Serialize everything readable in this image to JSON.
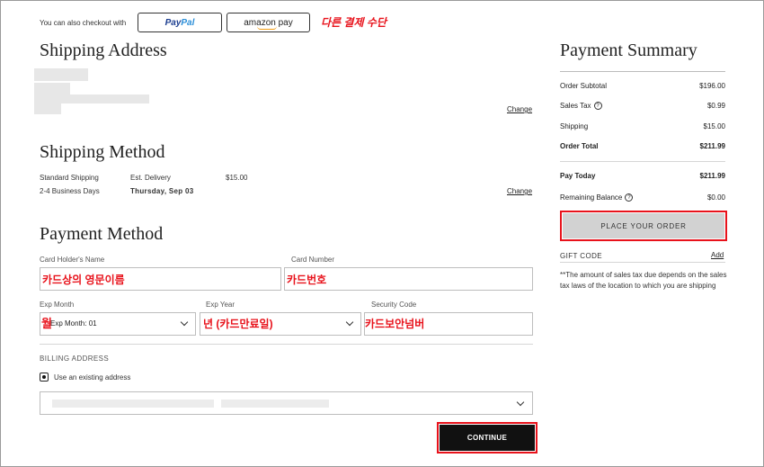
{
  "checkout": {
    "text": "You can also checkout with",
    "paypal_a": "Pay",
    "paypal_b": "Pal",
    "amazon": "amazon pay",
    "annotation": "다른 결제 수단"
  },
  "shipping_address": {
    "title": "Shipping Address",
    "change": "Change"
  },
  "shipping_method": {
    "title": "Shipping Method",
    "name": "Standard Shipping",
    "days": "2-4 Business Days",
    "est_label": "Est. Delivery",
    "est_date": "Thursday, Sep 03",
    "price": "$15.00",
    "change": "Change"
  },
  "payment_method": {
    "title": "Payment Method",
    "holder_label": "Card Holder's Name",
    "holder_annot": "카드상의 영문이름",
    "number_label": "Card Number",
    "number_annot": "카드번호",
    "exp_month_label": "Exp Month",
    "exp_month_value": "Exp Month: 01",
    "exp_month_annot": "월",
    "exp_year_label": "Exp Year",
    "exp_year_annot": "년 (카드만료일)",
    "security_label": "Security Code",
    "security_annot": "카드보안넘버",
    "billing_label": "BILLING ADDRESS",
    "existing_address": "Use an existing address",
    "continue": "CONTINUE"
  },
  "summary": {
    "title": "Payment Summary",
    "rows": [
      {
        "label": "Order Subtotal",
        "value": "$196.00"
      },
      {
        "label": "Sales Tax",
        "value": "$0.99"
      },
      {
        "label": "Shipping",
        "value": "$15.00"
      },
      {
        "label": "Order Total",
        "value": "$211.99"
      },
      {
        "label": "Pay Today",
        "value": "$211.99"
      },
      {
        "label": "Remaining Balance",
        "value": "$0.00"
      }
    ],
    "help_icon": "?",
    "place_order": "PLACE YOUR ORDER",
    "gift_code": "GIFT CODE",
    "gift_add": "Add",
    "note": "**The amount of sales tax due depends on the sales tax laws of the location to which you are shipping"
  },
  "colors": {
    "annotation": "#e8121b",
    "button_dark": "#111111",
    "button_disabled": "#d2d2d2"
  }
}
